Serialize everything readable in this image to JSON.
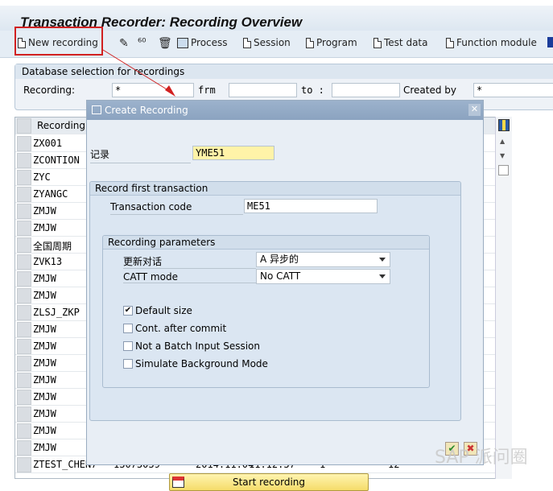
{
  "title": "Transaction Recorder: Recording Overview",
  "toolbar": {
    "new_recording": "New recording",
    "process": "Process",
    "session": "Session",
    "program": "Program",
    "test_data": "Test data",
    "function_module": "Function module"
  },
  "selection": {
    "header": "Database selection for recordings",
    "recording_label": "Recording:",
    "recording_value": "*",
    "from_label": "frm",
    "to_label": "to :",
    "created_by_label": "Created by",
    "created_by_value": "*"
  },
  "table": {
    "header": "Recording",
    "rows": [
      "ZX001",
      "ZCONTION",
      "ZYC",
      "ZYANGC",
      "ZMJW",
      "ZMJW",
      "全国周期",
      "ZVK13",
      "ZMJW",
      "ZMJW",
      "ZLSJ_ZKP",
      "ZMJW",
      "ZMJW",
      "ZMJW",
      "ZMJW",
      "ZMJW",
      "ZMJW",
      "ZMJW",
      "ZMJW"
    ],
    "last_row": {
      "recording": "ZTEST_CHEN7",
      "user": "13073039",
      "date": "2014.11.04",
      "time": "11:12:37",
      "c1": "1",
      "c2": "12"
    }
  },
  "dialog": {
    "title": "Create Recording",
    "record_label": "记录",
    "record_value": "YME51",
    "first_tx_header": "Record first transaction",
    "tcode_label": "Transaction code",
    "tcode_value": "ME51",
    "params_header": "Recording parameters",
    "update_label": "更新对话",
    "update_value": "A 异步的",
    "catt_label": "CATT mode",
    "catt_value": "No CATT",
    "checkboxes": [
      {
        "label": "Default size",
        "checked": true
      },
      {
        "label": "Cont. after commit",
        "checked": false
      },
      {
        "label": "Not a Batch Input Session",
        "checked": false
      },
      {
        "label": "Simulate Background Mode",
        "checked": false
      }
    ],
    "start_button": "Start recording"
  },
  "watermark": "SAP 派问圈",
  "colors": {
    "highlight": "#d12020",
    "dialog_header": "#8ba3c0",
    "required_field": "#fff3a8",
    "button": "#f5dc6a"
  }
}
